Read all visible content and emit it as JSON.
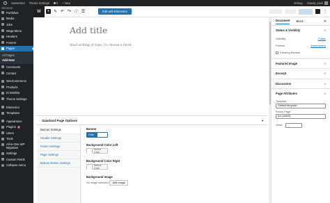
{
  "adminbar": {
    "site_name": "Sasseland",
    "theme_settings": "Theme Settings",
    "comments_count": "0",
    "new_label": "+ New",
    "debug": "Debug",
    "howdy": "Howdy, pixel"
  },
  "sidebar": {
    "items": [
      {
        "label": "Services"
      },
      {
        "label": "Portfolios"
      },
      {
        "label": "Media"
      },
      {
        "label": "Jobs"
      },
      {
        "label": "Mega Menu"
      },
      {
        "label": "Headers"
      },
      {
        "label": "Footers"
      },
      {
        "label": "Pages"
      }
    ],
    "pages_sub": [
      "All Pages",
      "Add New"
    ],
    "items_after": [
      {
        "label": "Comments"
      },
      {
        "label": "Contact"
      },
      {
        "label": "WooCommerce"
      },
      {
        "label": "Products"
      },
      {
        "label": "El Wishlist"
      },
      {
        "label": "Theme Settings"
      },
      {
        "label": "Elementor"
      },
      {
        "label": "Templates"
      },
      {
        "label": "Appearance"
      },
      {
        "label": "Plugins",
        "badge": "6"
      },
      {
        "label": "Users"
      },
      {
        "label": "Tools"
      },
      {
        "label": "All-in-One WP Migration"
      },
      {
        "label": "Settings"
      },
      {
        "label": "Custom Fields"
      },
      {
        "label": "Collapse menu"
      }
    ]
  },
  "editor_header": {
    "elementor_button": "Edit with Elementor",
    "more": "⋮"
  },
  "canvas": {
    "title_placeholder": "Add title",
    "paragraph_placeholder": "Start writing or type / to choose a block"
  },
  "metabox": {
    "title": "Saasland Page Options",
    "tabs": [
      "Banner Settings",
      "Header Settings",
      "Footer Settings",
      "Page Settings",
      "Bottom Button Settings"
    ],
    "banner_label": "Banner",
    "banner_toggle": "Hide",
    "bg_color_left_label": "Background Color Left",
    "bg_color_right_label": "Background Color Right",
    "select_color": "Select Color",
    "bg_image_label": "Background Image",
    "no_image": "No image selected",
    "add_image": "Add Image"
  },
  "settings": {
    "tabs": [
      "Document",
      "Block"
    ],
    "close": "✕",
    "status_title": "Status & Visibility",
    "visibility_label": "Visibility",
    "visibility_value": "Public",
    "publish_label": "Publish",
    "publish_value": "Immediately",
    "pending_review": "Pending Review",
    "featured_image": "Featured Image",
    "excerpt": "Excerpt",
    "discussion": "Discussion",
    "page_attributes": "Page Attributes",
    "template_label": "Template:",
    "template_value": "Default template",
    "parent_label": "Parent Page:",
    "parent_value": "(no parent)",
    "order_label": "Order"
  }
}
